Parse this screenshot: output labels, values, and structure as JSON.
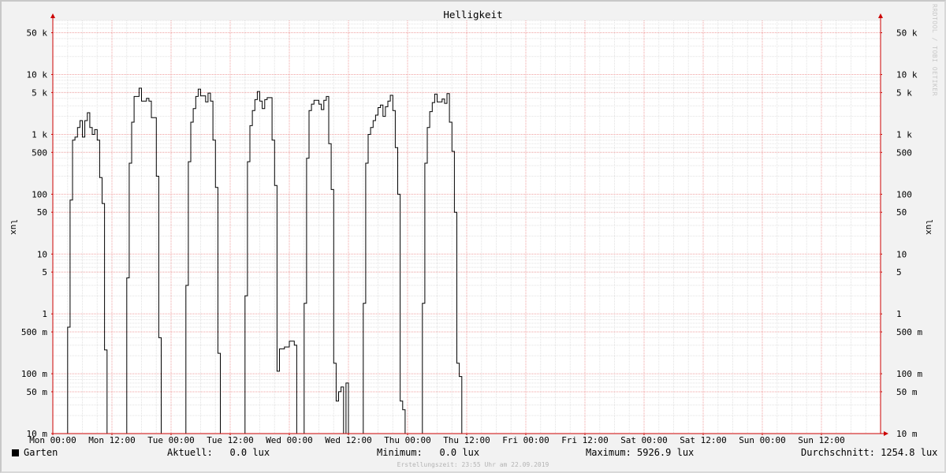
{
  "chart_data": {
    "type": "line",
    "title": "Helligkeit",
    "ylabel": "lux",
    "yscale": "log",
    "ylim": [
      0.01,
      80000
    ],
    "xlim_hours": [
      0,
      168
    ],
    "y_ticks": [
      {
        "v": 50000,
        "label": "50 k"
      },
      {
        "v": 10000,
        "label": "10 k"
      },
      {
        "v": 5000,
        "label": "5 k"
      },
      {
        "v": 1000,
        "label": "1 k"
      },
      {
        "v": 500,
        "label": "500"
      },
      {
        "v": 100,
        "label": "100"
      },
      {
        "v": 50,
        "label": "50"
      },
      {
        "v": 10,
        "label": "10"
      },
      {
        "v": 5,
        "label": "5"
      },
      {
        "v": 1,
        "label": "1"
      },
      {
        "v": 0.5,
        "label": "500 m"
      },
      {
        "v": 0.1,
        "label": "100 m"
      },
      {
        "v": 0.05,
        "label": "50 m"
      },
      {
        "v": 0.01,
        "label": "10 m"
      }
    ],
    "x_ticks": [
      "Mon 00:00",
      "Mon 12:00",
      "Tue 00:00",
      "Tue 12:00",
      "Wed 00:00",
      "Wed 12:00",
      "Thu 00:00",
      "Thu 12:00",
      "Fri 00:00",
      "Fri 12:00",
      "Sat 00:00",
      "Sat 12:00",
      "Sun 00:00",
      "Sun 12:00"
    ],
    "grid": true,
    "series": [
      {
        "name": "Garten",
        "color": "#000000",
        "points": [
          [
            0,
            0.01
          ],
          [
            3.0,
            0.01
          ],
          [
            3.0,
            0.6
          ],
          [
            3.5,
            0.6
          ],
          [
            3.5,
            80
          ],
          [
            4.0,
            80
          ],
          [
            4.0,
            800
          ],
          [
            4.5,
            800
          ],
          [
            4.5,
            900
          ],
          [
            5.0,
            900
          ],
          [
            5.0,
            1300
          ],
          [
            5.5,
            1300
          ],
          [
            5.5,
            1700
          ],
          [
            6.0,
            1700
          ],
          [
            6.0,
            900
          ],
          [
            6.5,
            900
          ],
          [
            6.5,
            1700
          ],
          [
            7.0,
            1700
          ],
          [
            7.0,
            2300
          ],
          [
            7.5,
            2300
          ],
          [
            7.5,
            1300
          ],
          [
            8.0,
            1300
          ],
          [
            8.0,
            1000
          ],
          [
            8.5,
            1000
          ],
          [
            8.5,
            1200
          ],
          [
            9.0,
            1200
          ],
          [
            9.0,
            800
          ],
          [
            9.5,
            800
          ],
          [
            9.5,
            190
          ],
          [
            10.0,
            190
          ],
          [
            10.0,
            70
          ],
          [
            10.5,
            70
          ],
          [
            10.5,
            0.25
          ],
          [
            11.0,
            0.25
          ],
          [
            11.0,
            0.01
          ],
          [
            15.0,
            0.01
          ],
          [
            15.0,
            4
          ],
          [
            15.5,
            4
          ],
          [
            15.5,
            330
          ],
          [
            16.0,
            330
          ],
          [
            16.0,
            1600
          ],
          [
            16.5,
            1600
          ],
          [
            16.5,
            4300
          ],
          [
            17.5,
            4300
          ],
          [
            17.5,
            5900
          ],
          [
            18.0,
            5900
          ],
          [
            18.0,
            3600
          ],
          [
            19.0,
            3600
          ],
          [
            19.0,
            4000
          ],
          [
            19.5,
            4000
          ],
          [
            19.5,
            3600
          ],
          [
            20.0,
            3600
          ],
          [
            20.0,
            1900
          ],
          [
            21.0,
            1900
          ],
          [
            21.0,
            200
          ],
          [
            21.5,
            200
          ],
          [
            21.5,
            0.4
          ],
          [
            22.0,
            0.4
          ],
          [
            22.0,
            0.01
          ],
          [
            27.0,
            0.01
          ],
          [
            27.0,
            3
          ],
          [
            27.5,
            3
          ],
          [
            27.5,
            350
          ],
          [
            28.0,
            350
          ],
          [
            28.0,
            1600
          ],
          [
            28.5,
            1600
          ],
          [
            28.5,
            2700
          ],
          [
            29.0,
            2700
          ],
          [
            29.0,
            4300
          ],
          [
            29.5,
            4300
          ],
          [
            29.5,
            5700
          ],
          [
            30.0,
            5700
          ],
          [
            30.0,
            4400
          ],
          [
            31.0,
            4400
          ],
          [
            31.0,
            3500
          ],
          [
            31.5,
            3500
          ],
          [
            31.5,
            4900
          ],
          [
            32.0,
            4900
          ],
          [
            32.0,
            3600
          ],
          [
            32.5,
            3600
          ],
          [
            32.5,
            800
          ],
          [
            33.0,
            800
          ],
          [
            33.0,
            130
          ],
          [
            33.5,
            130
          ],
          [
            33.5,
            0.22
          ],
          [
            34.0,
            0.22
          ],
          [
            34.0,
            0.01
          ],
          [
            39.0,
            0.01
          ],
          [
            39.0,
            2
          ],
          [
            39.5,
            2
          ],
          [
            39.5,
            350
          ],
          [
            40.0,
            350
          ],
          [
            40.0,
            1400
          ],
          [
            40.5,
            1400
          ],
          [
            40.5,
            2500
          ],
          [
            41.0,
            2500
          ],
          [
            41.0,
            3800
          ],
          [
            41.5,
            3800
          ],
          [
            41.5,
            5200
          ],
          [
            42.0,
            5200
          ],
          [
            42.0,
            3600
          ],
          [
            42.5,
            3600
          ],
          [
            42.5,
            2700
          ],
          [
            43.0,
            2700
          ],
          [
            43.0,
            3800
          ],
          [
            43.5,
            3800
          ],
          [
            43.5,
            4100
          ],
          [
            44.5,
            4100
          ],
          [
            44.5,
            800
          ],
          [
            45.0,
            800
          ],
          [
            45.0,
            140
          ],
          [
            45.5,
            140
          ],
          [
            45.5,
            0.11
          ],
          [
            46.0,
            0.11
          ],
          [
            46.0,
            0.26
          ],
          [
            47.0,
            0.26
          ],
          [
            47.0,
            0.28
          ],
          [
            48.0,
            0.28
          ],
          [
            48.0,
            0.35
          ],
          [
            49.0,
            0.35
          ],
          [
            49.0,
            0.3
          ],
          [
            49.5,
            0.3
          ],
          [
            49.5,
            0.01
          ],
          [
            51.0,
            0.01
          ],
          [
            51.0,
            1.5
          ],
          [
            51.5,
            1.5
          ],
          [
            51.5,
            400
          ],
          [
            52.0,
            400
          ],
          [
            52.0,
            2500
          ],
          [
            52.5,
            2500
          ],
          [
            52.5,
            3200
          ],
          [
            53.0,
            3200
          ],
          [
            53.0,
            3700
          ],
          [
            54.0,
            3700
          ],
          [
            54.0,
            3200
          ],
          [
            54.5,
            3200
          ],
          [
            54.5,
            2600
          ],
          [
            55.0,
            2600
          ],
          [
            55.0,
            3700
          ],
          [
            55.5,
            3700
          ],
          [
            55.5,
            4300
          ],
          [
            56.0,
            4300
          ],
          [
            56.0,
            700
          ],
          [
            56.5,
            700
          ],
          [
            56.5,
            120
          ],
          [
            57.0,
            120
          ],
          [
            57.0,
            0.15
          ],
          [
            57.5,
            0.15
          ],
          [
            57.5,
            0.035
          ],
          [
            58.0,
            0.035
          ],
          [
            58.0,
            0.05
          ],
          [
            58.5,
            0.05
          ],
          [
            58.5,
            0.06
          ],
          [
            59.0,
            0.06
          ],
          [
            59.0,
            0.01
          ],
          [
            59.5,
            0.01
          ],
          [
            59.5,
            0.07
          ],
          [
            60.0,
            0.07
          ],
          [
            60.0,
            0.01
          ],
          [
            63.0,
            0.01
          ],
          [
            63.0,
            1.5
          ],
          [
            63.5,
            1.5
          ],
          [
            63.5,
            330
          ],
          [
            64.0,
            330
          ],
          [
            64.0,
            1000
          ],
          [
            64.5,
            1000
          ],
          [
            64.5,
            1300
          ],
          [
            65.0,
            1300
          ],
          [
            65.0,
            1700
          ],
          [
            65.5,
            1700
          ],
          [
            65.5,
            2100
          ],
          [
            66.0,
            2100
          ],
          [
            66.0,
            2800
          ],
          [
            66.5,
            2800
          ],
          [
            66.5,
            3100
          ],
          [
            67.0,
            3100
          ],
          [
            67.0,
            2000
          ],
          [
            67.5,
            2000
          ],
          [
            67.5,
            2900
          ],
          [
            68.0,
            2900
          ],
          [
            68.0,
            3600
          ],
          [
            68.5,
            3600
          ],
          [
            68.5,
            4500
          ],
          [
            69.0,
            4500
          ],
          [
            69.0,
            2500
          ],
          [
            69.5,
            2500
          ],
          [
            69.5,
            600
          ],
          [
            70.0,
            600
          ],
          [
            70.0,
            100
          ],
          [
            70.5,
            100
          ],
          [
            70.5,
            0.035
          ],
          [
            71.0,
            0.035
          ],
          [
            71.0,
            0.025
          ],
          [
            71.5,
            0.025
          ],
          [
            71.5,
            0.01
          ],
          [
            75.0,
            0.01
          ],
          [
            75.0,
            1.5
          ],
          [
            75.5,
            1.5
          ],
          [
            75.5,
            330
          ],
          [
            76.0,
            330
          ],
          [
            76.0,
            1300
          ],
          [
            76.5,
            1300
          ],
          [
            76.5,
            2400
          ],
          [
            77.0,
            2400
          ],
          [
            77.0,
            3400
          ],
          [
            77.5,
            3400
          ],
          [
            77.5,
            4700
          ],
          [
            78.0,
            4700
          ],
          [
            78.0,
            3500
          ],
          [
            79.0,
            3500
          ],
          [
            79.0,
            3900
          ],
          [
            79.5,
            3900
          ],
          [
            79.5,
            3300
          ],
          [
            80.0,
            3300
          ],
          [
            80.0,
            4800
          ],
          [
            80.5,
            4800
          ],
          [
            80.5,
            1600
          ],
          [
            81.0,
            1600
          ],
          [
            81.0,
            520
          ],
          [
            81.5,
            520
          ],
          [
            81.5,
            50
          ],
          [
            82.0,
            50
          ],
          [
            82.0,
            0.15
          ],
          [
            82.5,
            0.15
          ],
          [
            82.5,
            0.09
          ],
          [
            83.0,
            0.09
          ],
          [
            83.0,
            0.01
          ],
          [
            83.5,
            0.01
          ]
        ]
      }
    ]
  },
  "legend": {
    "series_name": "Garten",
    "current_label": "Aktuell:",
    "current_value": "0.0 lux",
    "min_label": "Minimum:",
    "min_value": "0.0 lux",
    "max_label": "Maximum:",
    "max_value": "5926.9 lux",
    "avg_label": "Durchschnitt:",
    "avg_value": "1254.8 lux"
  },
  "footer": {
    "created": "Erstellungszeit: 23:55 Uhr am 22.09.2019",
    "watermark": "RRDTOOL / TOBI OETIKER"
  }
}
